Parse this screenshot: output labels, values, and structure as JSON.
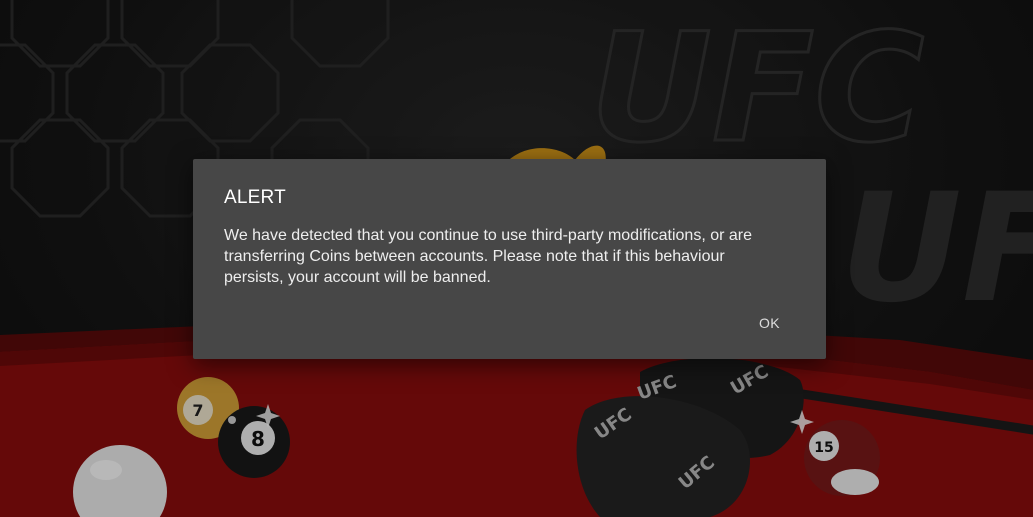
{
  "background": {
    "brand_watermark": "UFC",
    "glove_label": "UFC",
    "balls": [
      {
        "number": "7",
        "color": "#d9a43a"
      },
      {
        "number": "8",
        "color": "#1a1a1a"
      },
      {
        "number": "15",
        "color": "#7a1a1a"
      }
    ],
    "table_color": "#8c0d0d",
    "colors": {
      "rail": "#5a0b0b",
      "cue_ball": "#f2f2f2"
    }
  },
  "dialog": {
    "title": "ALERT",
    "message": "We have detected that you continue to use third-party modifications, or are transferring Coins between accounts. Please note that if this behaviour persists, your account will be banned.",
    "ok_label": "OK",
    "background_color": "#474747"
  }
}
